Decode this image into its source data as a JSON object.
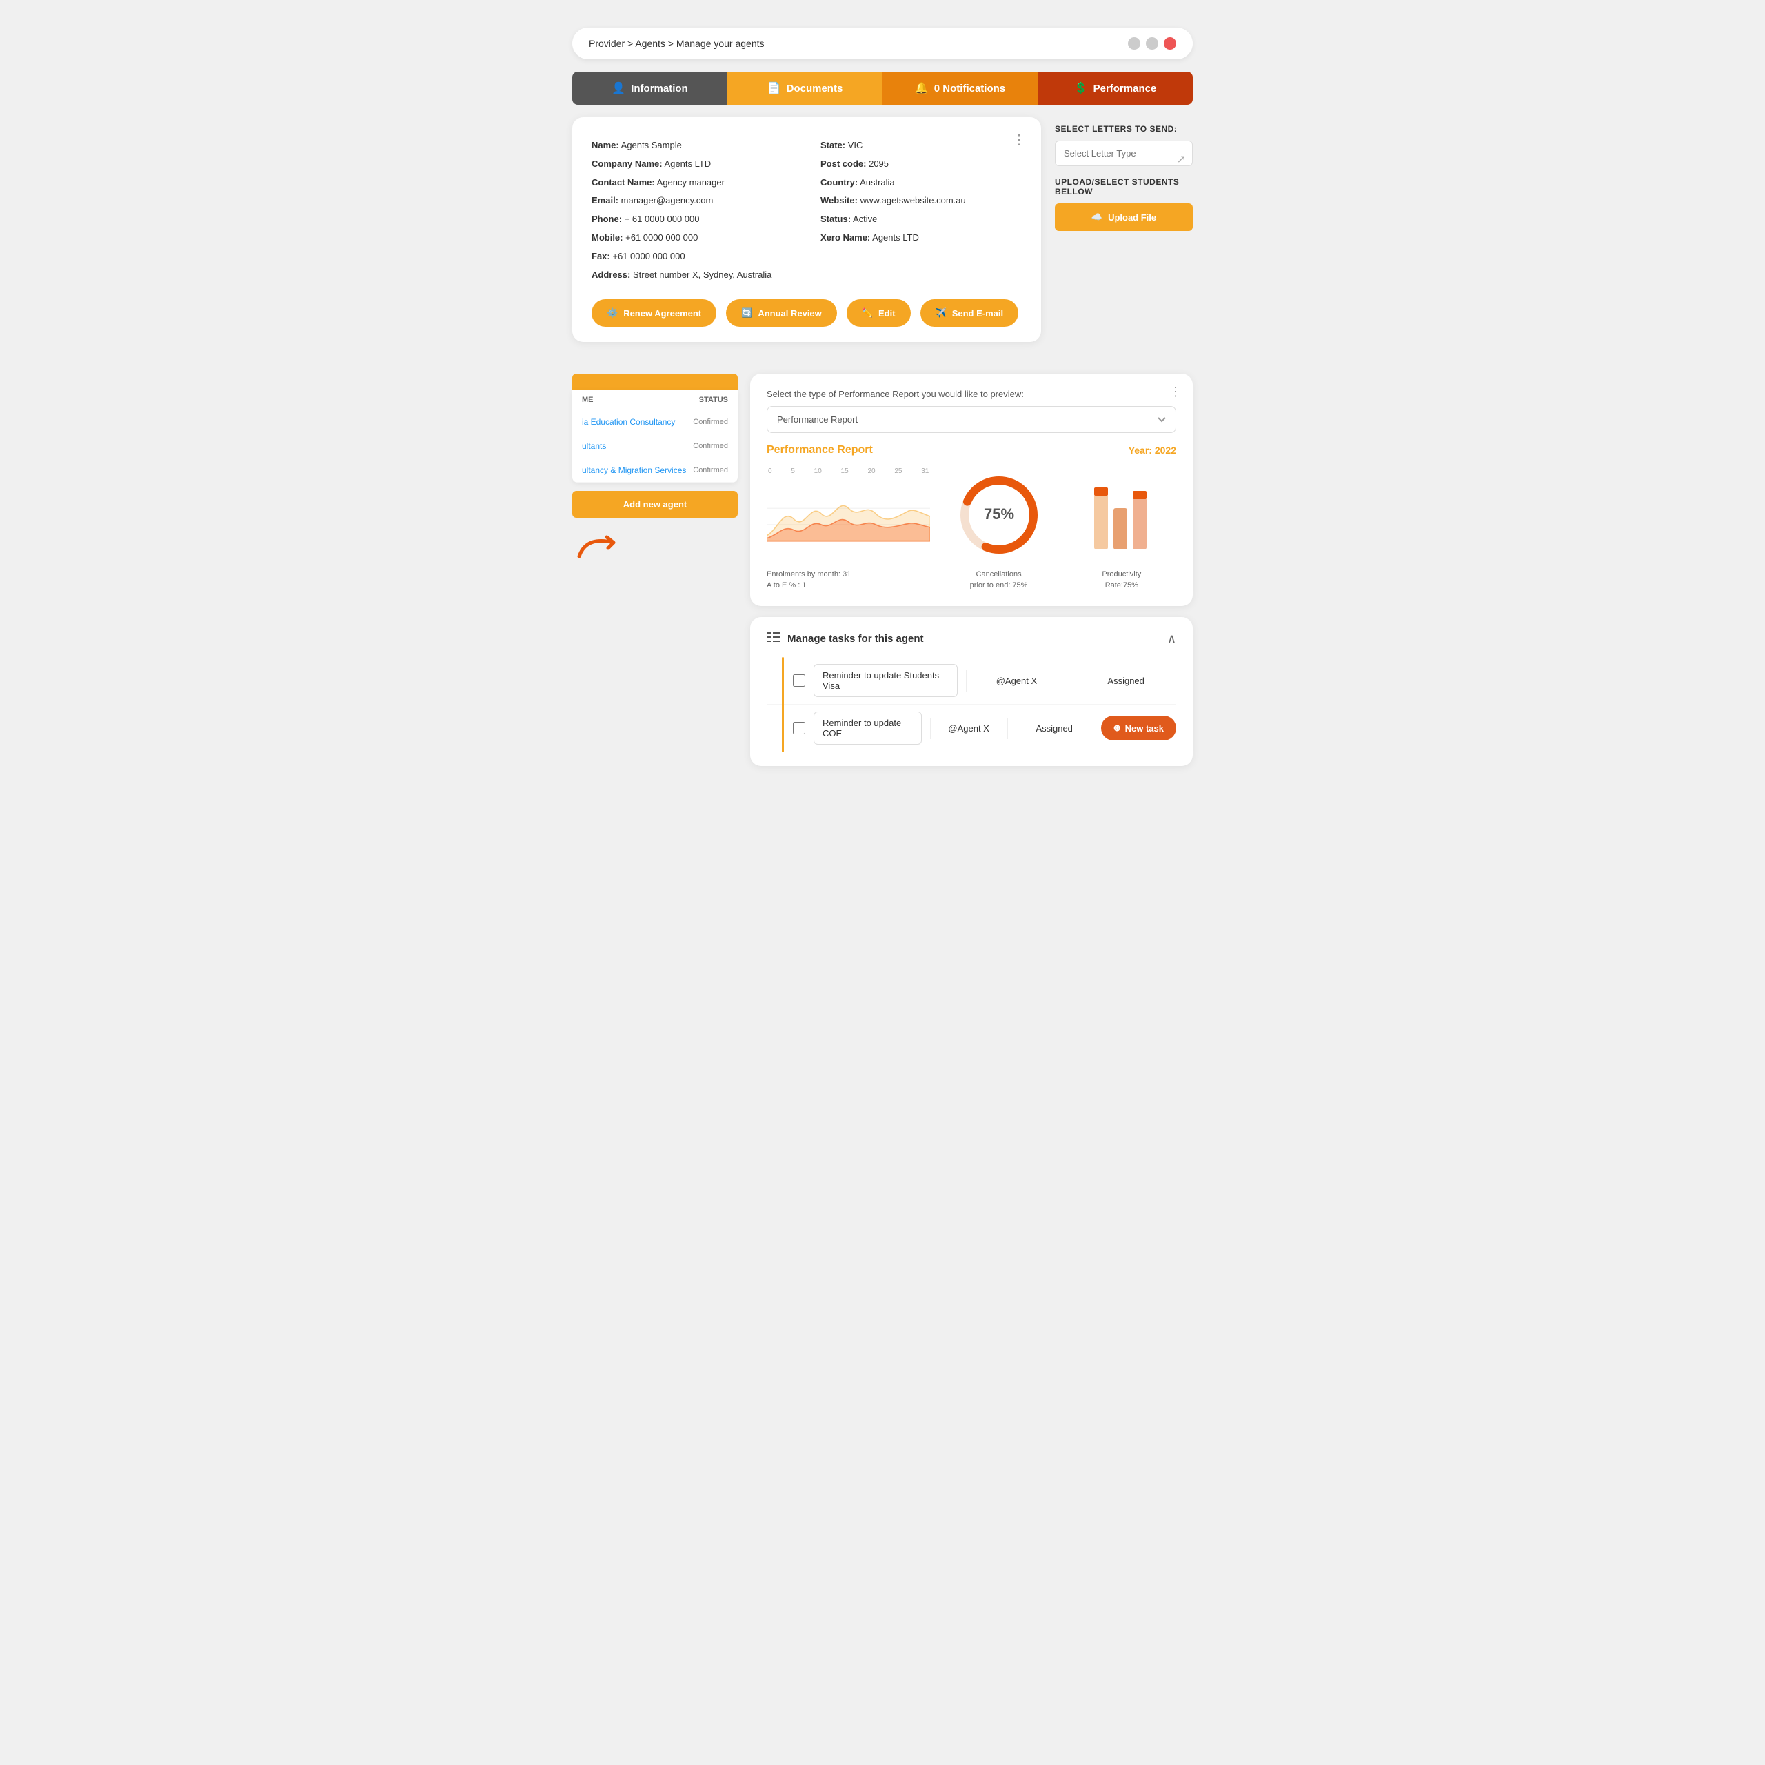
{
  "browser": {
    "title": "Provider > Agents > Manage your agents"
  },
  "tabs": [
    {
      "id": "information",
      "label": "Information",
      "icon": "👤",
      "bg": "#555555"
    },
    {
      "id": "documents",
      "label": "Documents",
      "icon": "📄",
      "bg": "#f5a623"
    },
    {
      "id": "notifications",
      "label": "0 Notifications",
      "icon": "🔔",
      "bg": "#e8820c"
    },
    {
      "id": "performance",
      "label": "Performance",
      "icon": "💲",
      "bg": "#c0390a"
    }
  ],
  "agent_info": {
    "name_label": "Name:",
    "name_value": "Agents Sample",
    "company_label": "Company Name:",
    "company_value": "Agents LTD",
    "contact_label": "Contact Name:",
    "contact_value": "Agency manager",
    "email_label": "Email:",
    "email_value": "manager@agency.com",
    "phone_label": "Phone:",
    "phone_value": "+ 61 0000 000 000",
    "mobile_label": "Mobile:",
    "mobile_value": "+61 0000 000 000",
    "fax_label": "Fax:",
    "fax_value": "+61 0000 000 000",
    "address_label": "Address:",
    "address_value": "Street number X, Sydney, Australia",
    "state_label": "State:",
    "state_value": "VIC",
    "postcode_label": "Post code:",
    "postcode_value": "2095",
    "country_label": "Country:",
    "country_value": "Australia",
    "website_label": "Website:",
    "website_value": "www.agetswebsite.com.au",
    "status_label": "Status:",
    "status_value": "Active",
    "xero_label": "Xero Name:",
    "xero_value": "Agents LTD"
  },
  "buttons": {
    "renew": "Renew Agreement",
    "annual": "Annual Review",
    "edit": "Edit",
    "send_email": "Send E-mail"
  },
  "right_panel": {
    "select_letters_title": "SELECT LETTERS TO SEND:",
    "select_placeholder": "Select Letter Type",
    "upload_title": "UPLOAD/SELECT STUDENTS BELLOW",
    "upload_btn": "Upload File"
  },
  "agents_table": {
    "header_status": "STATUS",
    "rows": [
      {
        "name": "ia Education Consultancy",
        "status": "Confirmed"
      },
      {
        "name": "ultants",
        "status": "Confirmed"
      },
      {
        "name": "ultancy & Migration Services",
        "status": "Confirmed"
      }
    ],
    "add_btn": "Add new agent"
  },
  "performance": {
    "select_label": "Select the type of Performance Report you would like to preview:",
    "dropdown_value": "Performance Report",
    "report_title": "Performance Report",
    "year_label": "Year: 2022",
    "x_axis": [
      "0",
      "5",
      "10",
      "15",
      "20",
      "25",
      "31"
    ],
    "enrolments_label": "Enrolments by month: 31",
    "ato_e_label": "A to E % : 1",
    "cancellations_label": "Cancellations",
    "cancellations_value": "prior to end: 75%",
    "productivity_label": "Productivity",
    "productivity_value": "Rate:75%",
    "donut_percent": "75%"
  },
  "tasks": {
    "title": "Manage tasks for this agent",
    "rows": [
      {
        "name": "Reminder to update Students Visa",
        "assignee": "@Agent X",
        "status": "Assigned"
      },
      {
        "name": "Reminder to update COE",
        "assignee": "@Agent X",
        "status": "Assigned"
      }
    ],
    "new_task_btn": "New task"
  }
}
